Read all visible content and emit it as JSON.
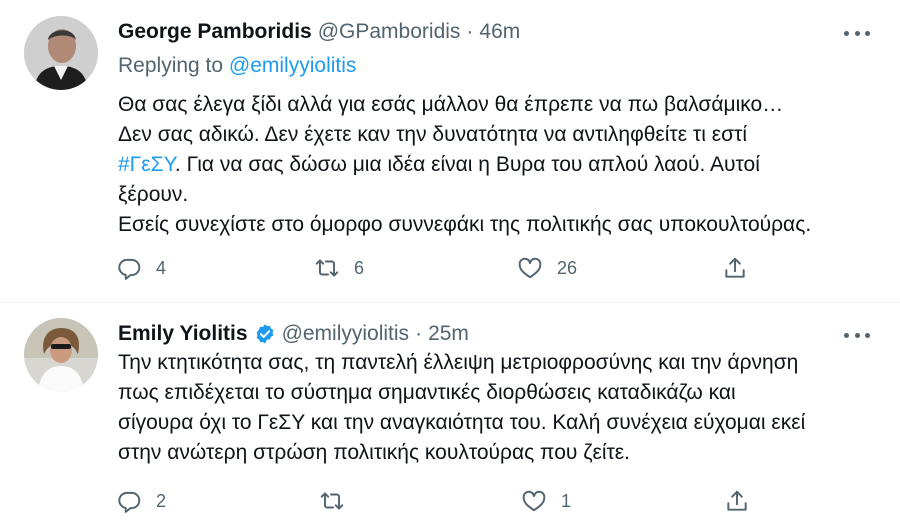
{
  "tweets": [
    {
      "author": {
        "name": "George Pamboridis",
        "handle": "@GPamboridis",
        "verified": false
      },
      "time": "46m",
      "separator": "·",
      "replying_label": "Replying to",
      "replying_to": "@emilyyiolitis",
      "text_lines": [
        "Θα σας έλεγα ξίδι αλλά για εσάς μάλλον θα έπρεπε να πω βαλσάμικο…",
        "Δεν σας αδικώ. Δεν έχετε καν την δυνατότητα να αντιληφθείτε τι εστί",
        {
          "hashtag": "#ΓεΣΥ",
          "rest": ". Για να σας δώσω μια ιδέα είναι η Βυρα του απλού λαού. Αυτοί"
        },
        "ξέρουν.",
        "Εσείς συνεχίστε στο όμορφο συννεφάκι της πολιτικής σας υποκουλτούρας."
      ],
      "stats": {
        "replies": "4",
        "retweets": "6",
        "likes": "26"
      }
    },
    {
      "author": {
        "name": "Emily Yiolitis",
        "handle": "@emilyyiolitis",
        "verified": true
      },
      "time": "25m",
      "separator": "·",
      "text_lines": [
        "Την κτητικότητα σας, τη παντελή έλλειψη μετριοφροσύνης και την άρνηση",
        "πως επιδέχεται το σύστημα σημαντικές διορθώσεις καταδικάζω και",
        "σίγουρα όχι το ΓεΣΥ και την αναγκαιότητα του. Καλή συνέχεια εύχομαι εκεί",
        "στην ανώτερη στρώση πολιτικής κουλτούρας που ζείτε."
      ],
      "stats": {
        "replies": "2",
        "retweets": "",
        "likes": "1"
      }
    }
  ],
  "icons": {
    "reply": "reply-icon",
    "retweet": "retweet-icon",
    "like": "like-icon",
    "share": "share-icon",
    "more": "more-icon",
    "verified": "verified-badge-icon"
  },
  "colors": {
    "link": "#1d9bf0",
    "text": "#0f1419",
    "secondary": "#536471",
    "divider": "#eff3f4"
  }
}
